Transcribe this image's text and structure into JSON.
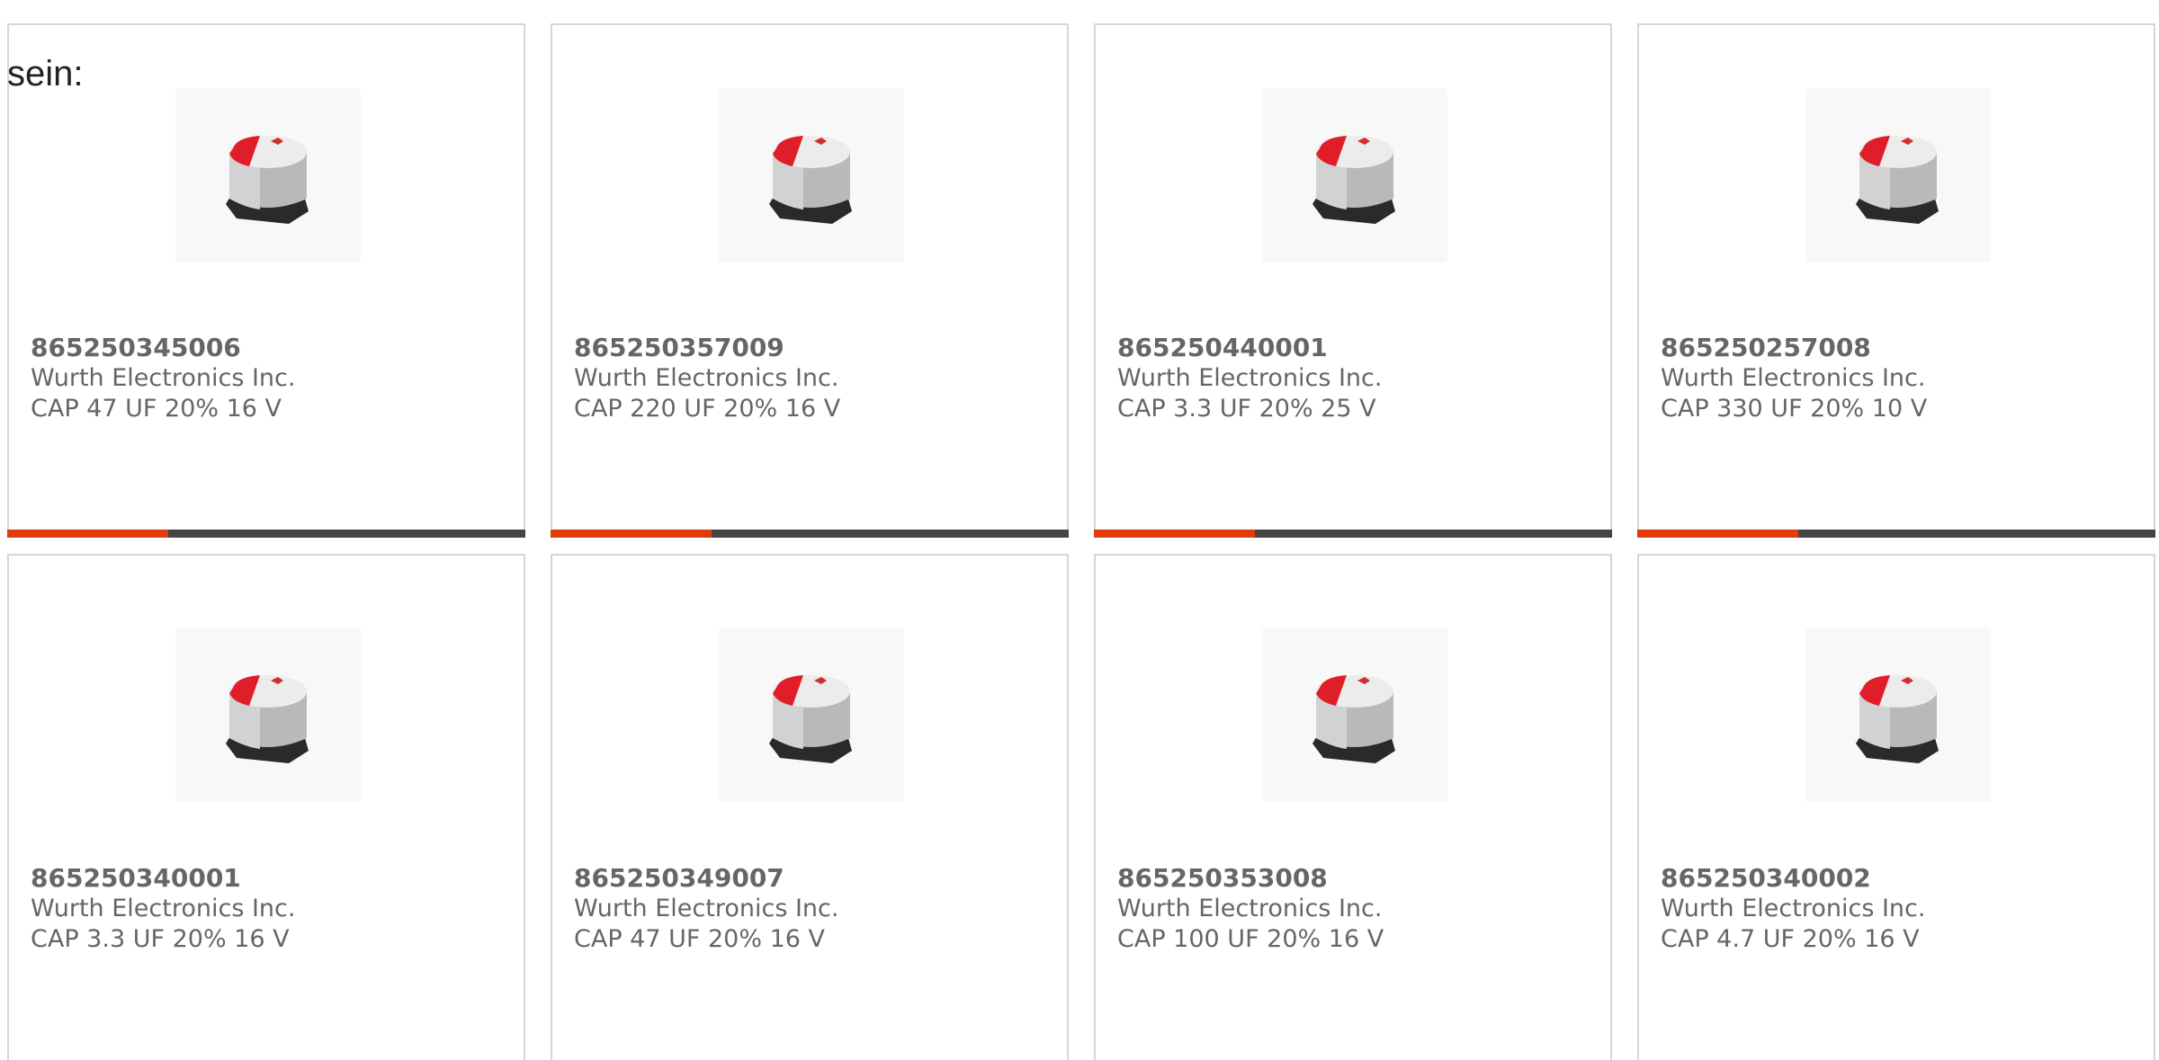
{
  "intro": {
    "text": "sein:"
  },
  "colors": {
    "border": "#d6d6d6",
    "text": "#666666",
    "accent": "#e03c0c",
    "track": "#444444"
  },
  "products": [
    {
      "part_number": "865250345006",
      "manufacturer": "Wurth Electronics Inc.",
      "description": "CAP 47 UF 20% 16 V",
      "image_icon": "capacitor-image",
      "progress": 0.31
    },
    {
      "part_number": "865250357009",
      "manufacturer": "Wurth Electronics Inc.",
      "description": "CAP 220 UF 20% 16 V",
      "image_icon": "capacitor-image",
      "progress": 0.31
    },
    {
      "part_number": "865250440001",
      "manufacturer": "Wurth Electronics Inc.",
      "description": "CAP 3.3 UF 20% 25 V",
      "image_icon": "capacitor-image",
      "progress": 0.31
    },
    {
      "part_number": "865250257008",
      "manufacturer": "Wurth Electronics Inc.",
      "description": "CAP 330 UF 20% 10 V",
      "image_icon": "capacitor-image",
      "progress": 0.31
    },
    {
      "part_number": "865250340001",
      "manufacturer": "Wurth Electronics Inc.",
      "description": "CAP 3.3 UF 20% 16 V",
      "image_icon": "capacitor-image"
    },
    {
      "part_number": "865250349007",
      "manufacturer": "Wurth Electronics Inc.",
      "description": "CAP 47 UF 20% 16 V",
      "image_icon": "capacitor-image"
    },
    {
      "part_number": "865250353008",
      "manufacturer": "Wurth Electronics Inc.",
      "description": "CAP 100 UF 20% 16 V",
      "image_icon": "capacitor-image"
    },
    {
      "part_number": "865250340002",
      "manufacturer": "Wurth Electronics Inc.",
      "description": "CAP 4.7 UF 20% 16 V",
      "image_icon": "capacitor-image"
    }
  ]
}
